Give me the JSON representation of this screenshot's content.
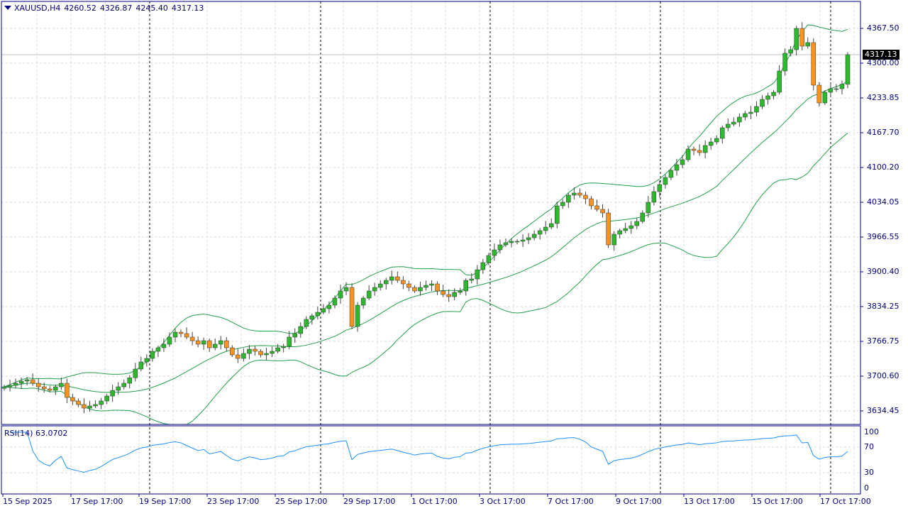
{
  "header": {
    "symbol": "XAUUSD,H4",
    "open": "4260.52",
    "high": "4326.87",
    "low": "4245.40",
    "close": "4317.13"
  },
  "rsi": {
    "label": "RSI(14) 63.0702",
    "levels": [
      "100",
      "70",
      "30",
      "0"
    ]
  },
  "current_price": "4317.13",
  "price_axis": [
    "4367.50",
    "4300.00",
    "4233.85",
    "4167.70",
    "4100.20",
    "4034.05",
    "3966.55",
    "3900.40",
    "3834.25",
    "3766.75",
    "3700.60",
    "3634.45"
  ],
  "time_axis": [
    "15 Sep 2025",
    "17 Sep 17:00",
    "19 Sep 17:00",
    "23 Sep 17:00",
    "25 Sep 17:00",
    "29 Sep 17:00",
    "1 Oct 17:00",
    "3 Oct 17:00",
    "7 Oct 17:00",
    "9 Oct 17:00",
    "13 Oct 17:00",
    "15 Oct 17:00",
    "17 Oct 17:00"
  ],
  "colors": {
    "frame": "#000080",
    "bull": "#2db82d",
    "bear": "#f7931e",
    "bands": "#22a04a",
    "rsi": "#1e90ff",
    "grid": "#d8d8d8"
  },
  "chart_data": {
    "type": "candlestick",
    "symbol": "XAUUSD",
    "timeframe": "H4",
    "ylim": [
      3612,
      4395
    ],
    "closes": [
      3680.7,
      3683.4,
      3687.5,
      3691.6,
      3694.3,
      3687.5,
      3680.7,
      3676.6,
      3673.9,
      3680.7,
      3687.5,
      3660.3,
      3653.5,
      3646.7,
      3639.9,
      3644,
      3646.7,
      3653.5,
      3663,
      3673.9,
      3680.7,
      3687.5,
      3698,
      3714.7,
      3728.3,
      3735.1,
      3748.7,
      3755.5,
      3762.3,
      3775.9,
      3785.4,
      3782.7,
      3775.9,
      3769.1,
      3762.3,
      3769.1,
      3755.5,
      3762.3,
      3769.1,
      3755.5,
      3741.9,
      3735.1,
      3744.6,
      3752.8,
      3748.7,
      3741.9,
      3744.6,
      3748.7,
      3755.5,
      3758.2,
      3775.9,
      3782.7,
      3796.3,
      3809.9,
      3816.7,
      3823.5,
      3830.3,
      3837.1,
      3850.7,
      3864.3,
      3871.1,
      3796.3,
      3837.1,
      3850.7,
      3864.3,
      3871.1,
      3877.9,
      3884.7,
      3891.5,
      3884.7,
      3877.9,
      3871.1,
      3864.3,
      3871.1,
      3875.2,
      3877.9,
      3864.3,
      3857.5,
      3853.4,
      3861.6,
      3864.3,
      3884.7,
      3887.4,
      3905.1,
      3918.7,
      3932.3,
      3943.2,
      3952.7,
      3956.8,
      3959.5,
      3959.5,
      3962.2,
      3966.3,
      3973.1,
      3979.9,
      3986.7,
      3993.5,
      4027.5,
      4034.3,
      4047.9,
      4052,
      4047.9,
      4041.1,
      4027.5,
      4020.7,
      4013.9,
      3952.7,
      3973.1,
      3979.9,
      3984,
      3989.4,
      3997.6,
      4013.9,
      4034.3,
      4054.7,
      4068.3,
      4081.9,
      4095.5,
      4106.4,
      4115.9,
      4136.3,
      4133.6,
      4129.5,
      4143.1,
      4149.9,
      4156.7,
      4177.1,
      4183.9,
      4188,
      4197.5,
      4204.3,
      4207,
      4217.9,
      4231.5,
      4238.3,
      4245.1,
      4285.9,
      4319.9,
      4326.7,
      4367.5,
      4333.5,
      4340.3,
      4258.7,
      4224.7,
      4245.1,
      4251.9,
      4251.9,
      4260.5,
      4317.13
    ]
  }
}
